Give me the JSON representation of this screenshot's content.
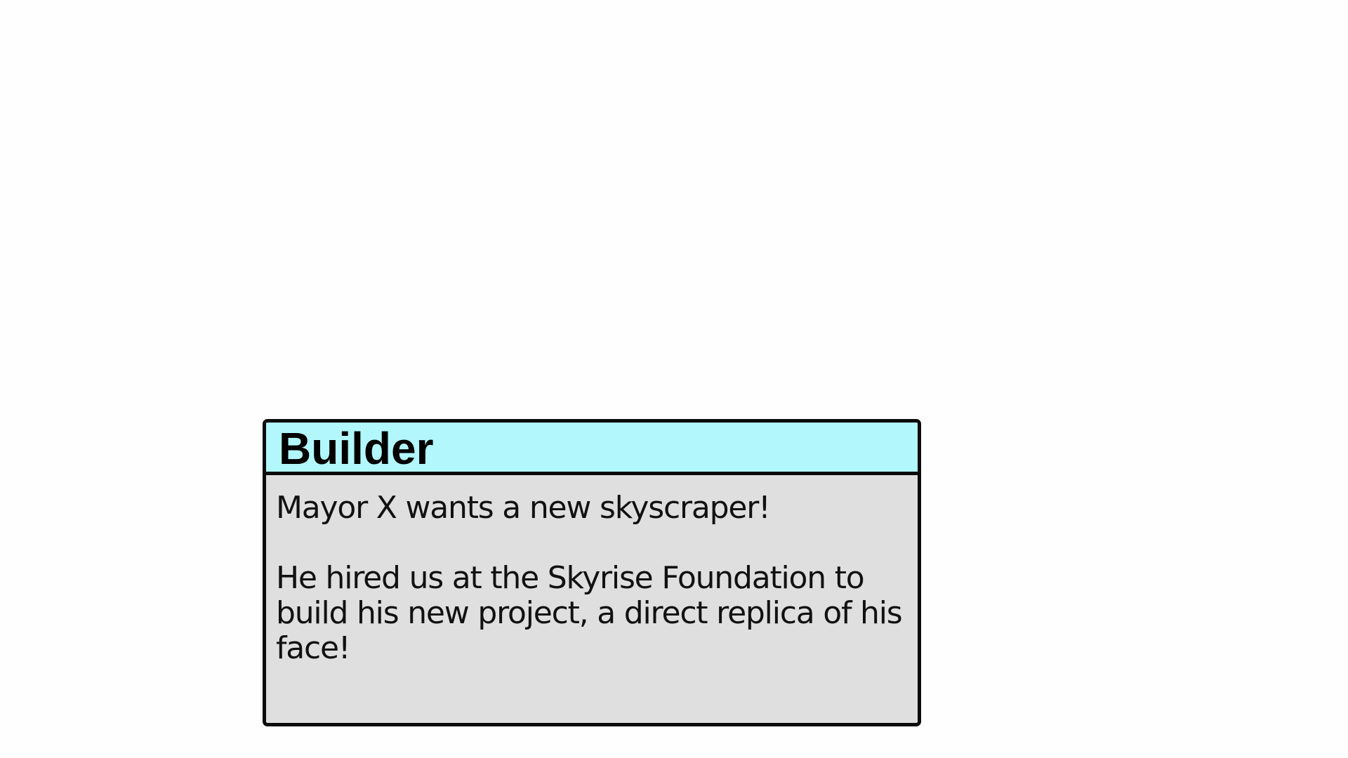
{
  "dialog": {
    "speaker": "Builder",
    "lines": [
      "Mayor X wants a new skyscraper!",
      "He hired us at the Skyrise Foundation to build his new project, a direct replica of his face!"
    ]
  },
  "colors": {
    "header_background": "#b2f7fb",
    "body_background": "#dfdfdf",
    "border": "#0b0b0b",
    "page_background": "#fefefe"
  }
}
